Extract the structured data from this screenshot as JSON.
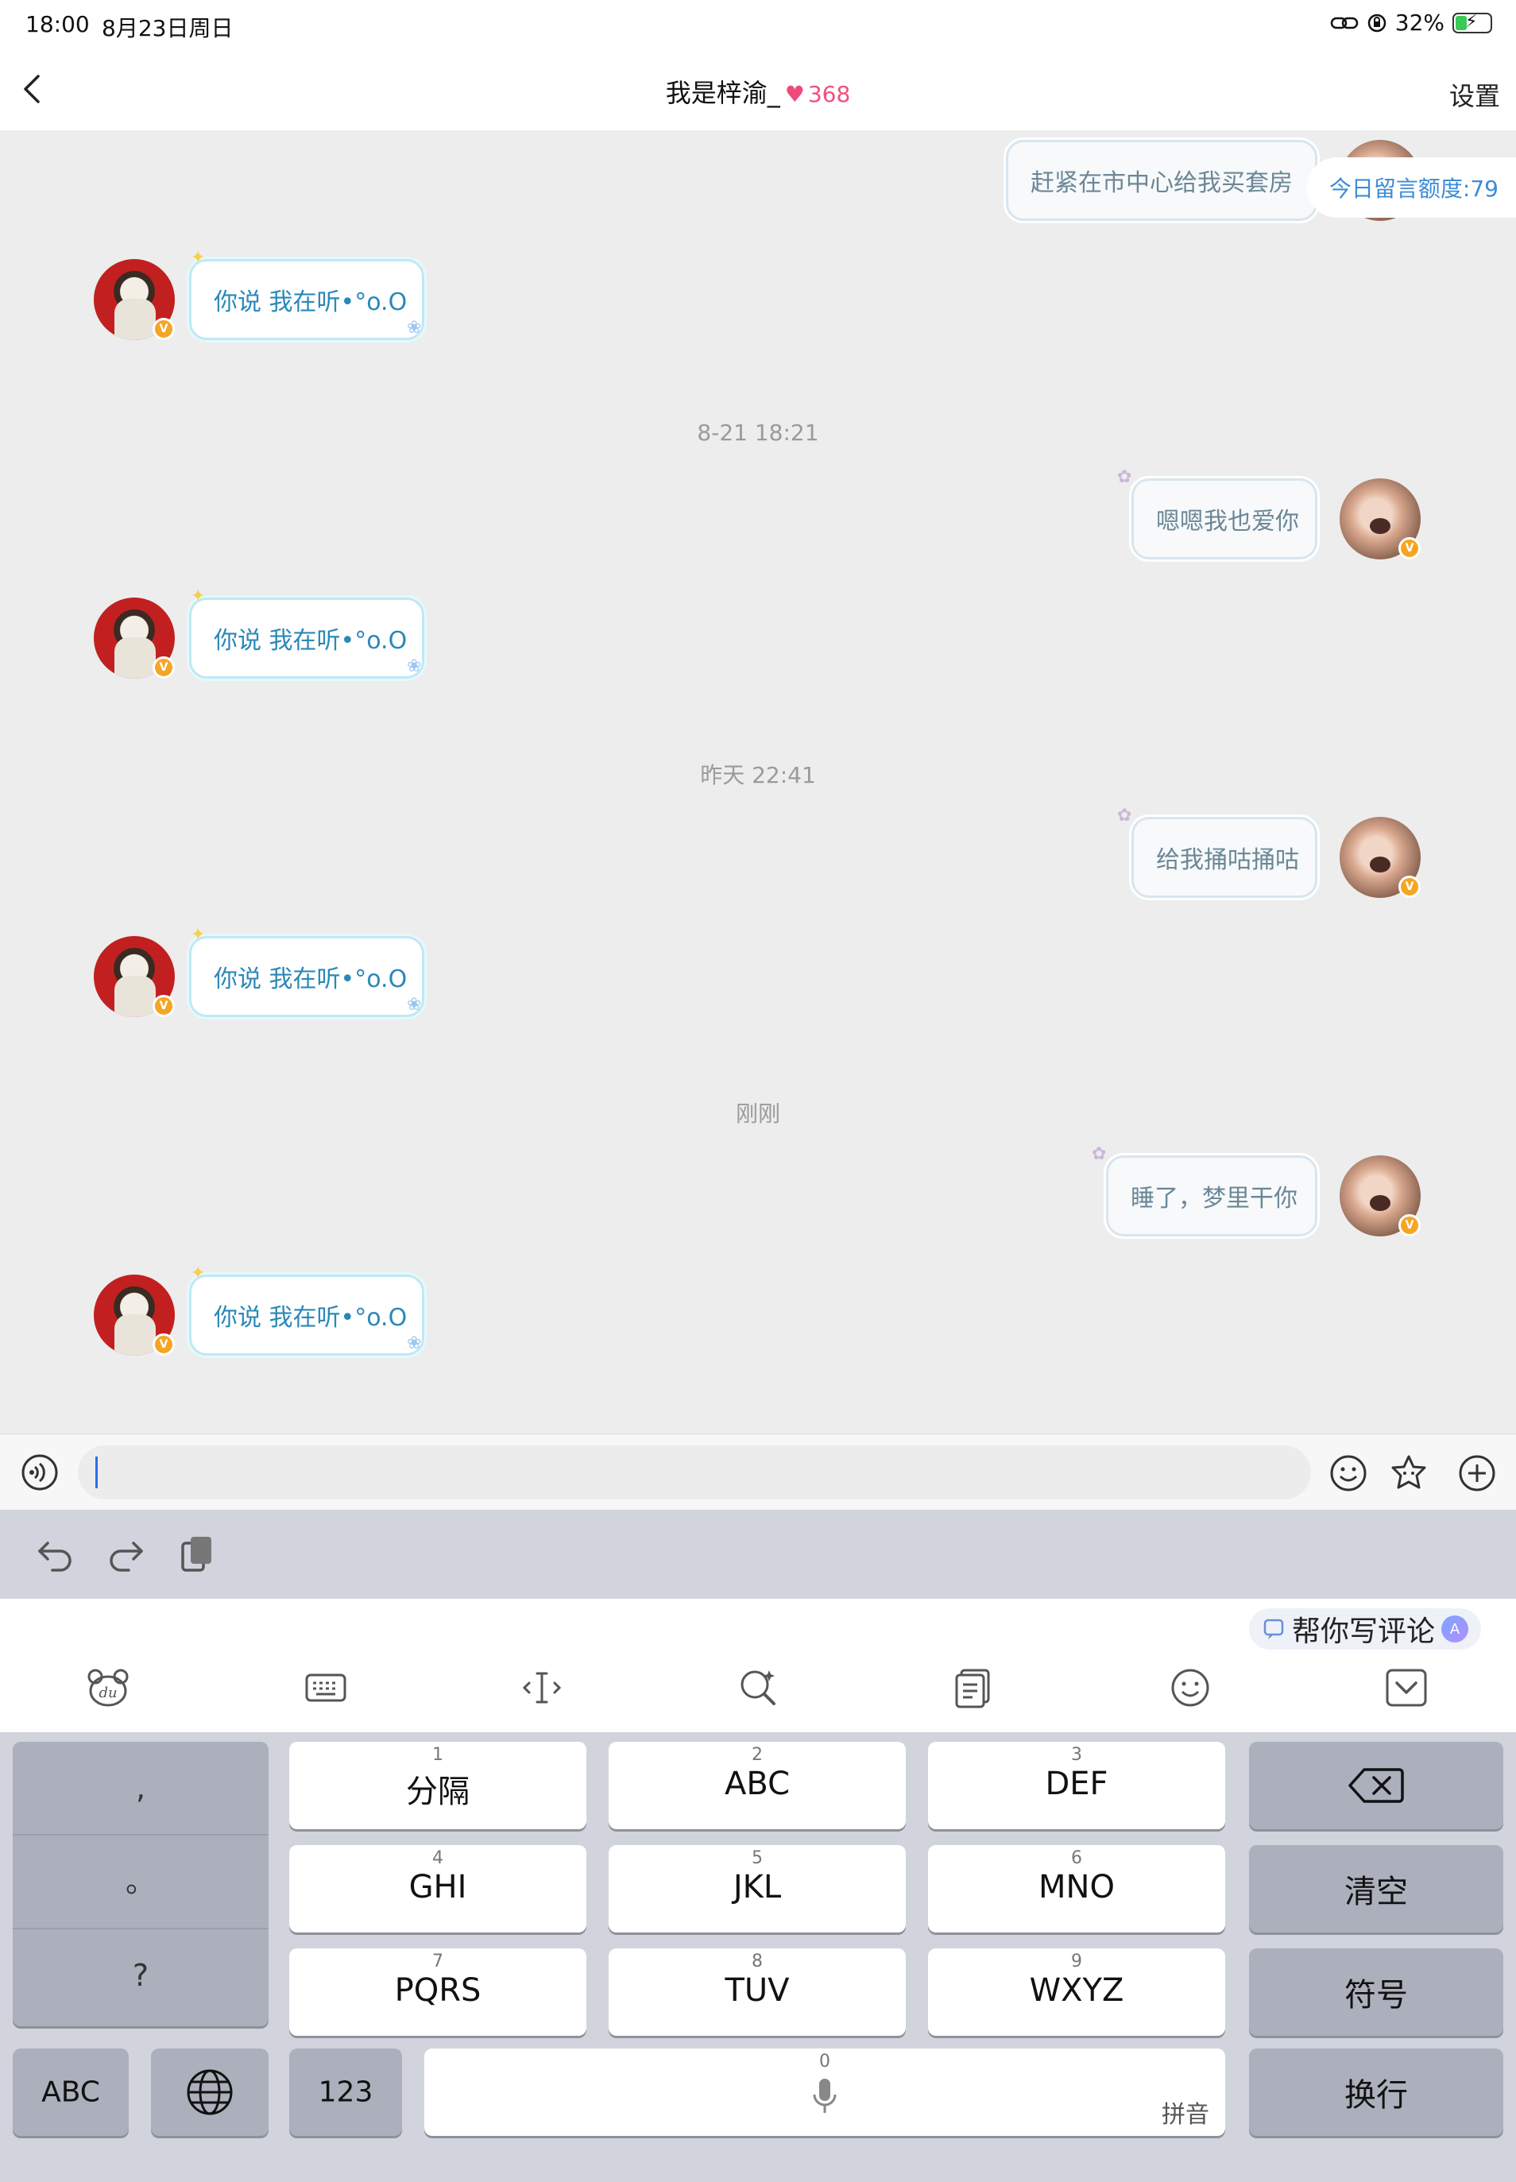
{
  "status_bar": {
    "time": "18:00",
    "date": "8月23日周日",
    "battery": "32%"
  },
  "header": {
    "title": "我是梓渝_",
    "heart": "♥",
    "intimacy": "368",
    "settings": "设置"
  },
  "quota_label": "今日留言额度:79",
  "messages": [
    {
      "side": "right",
      "text": "赶紧在市中心给我买套房"
    },
    {
      "side": "left",
      "text": "你说 我在听•°o.O"
    },
    {
      "side": "timestamp",
      "text": "8-21 18:21"
    },
    {
      "side": "right",
      "text": "嗯嗯我也爱你"
    },
    {
      "side": "left",
      "text": "你说 我在听•°o.O"
    },
    {
      "side": "timestamp",
      "text": "昨天 22:41"
    },
    {
      "side": "right",
      "text": "给我捅咕捅咕"
    },
    {
      "side": "left",
      "text": "你说 我在听•°o.O"
    },
    {
      "side": "timestamp",
      "text": "刚刚"
    },
    {
      "side": "right",
      "text": "睡了，梦里干你"
    },
    {
      "side": "left",
      "text": "你说 我在听•°o.O"
    }
  ],
  "input": {
    "value": ""
  },
  "ime": {
    "writer_label": "帮你写评论",
    "ai_badge": "A"
  },
  "keyboard": {
    "punct": [
      ",",
      "。",
      "?"
    ],
    "keys": [
      {
        "num": "1",
        "label": "分隔"
      },
      {
        "num": "2",
        "label": "ABC"
      },
      {
        "num": "3",
        "label": "DEF"
      },
      {
        "num": "4",
        "label": "GHI"
      },
      {
        "num": "5",
        "label": "JKL"
      },
      {
        "num": "6",
        "label": "MNO"
      },
      {
        "num": "7",
        "label": "PQRS"
      },
      {
        "num": "8",
        "label": "TUV"
      },
      {
        "num": "9",
        "label": "WXYZ"
      }
    ],
    "clear": "清空",
    "symbols": "符号",
    "abc": "ABC",
    "num123": "123",
    "space_num": "0",
    "space_sub": "拼音",
    "enter": "换行"
  }
}
